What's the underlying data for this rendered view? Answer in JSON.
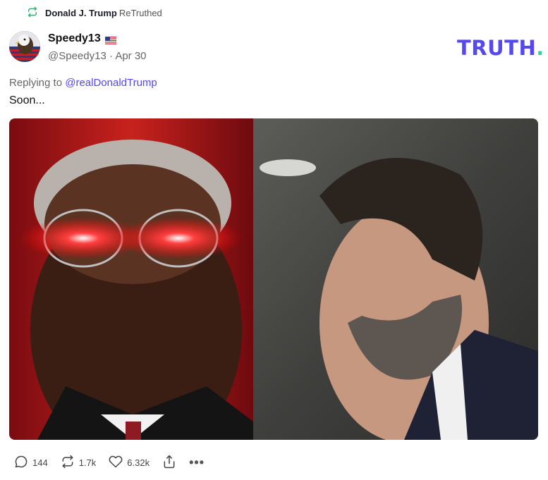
{
  "retruth": {
    "name": "Donald J. Trump",
    "label": "ReTruthed"
  },
  "post": {
    "author_name": "Speedy13",
    "handle": "@Speedy13",
    "separator": "·",
    "date": "Apr 30",
    "replying_prefix": "Replying to",
    "replying_to": "@realDonaldTrump",
    "text": "Soon..."
  },
  "brand": {
    "logo_text": "TRUTH",
    "logo_dot": ".",
    "primary_color": "#5448ee",
    "accent_color": "#35d2a6",
    "retruth_icon_color": "#2bb673"
  },
  "actions": {
    "replies": "144",
    "retruths": "1.7k",
    "likes": "6.32k",
    "more": "•••"
  },
  "icons": [
    "retruth-icon",
    "flag-us-icon",
    "reply-icon",
    "retruth-action-icon",
    "heart-icon",
    "share-icon",
    "more-icon"
  ]
}
